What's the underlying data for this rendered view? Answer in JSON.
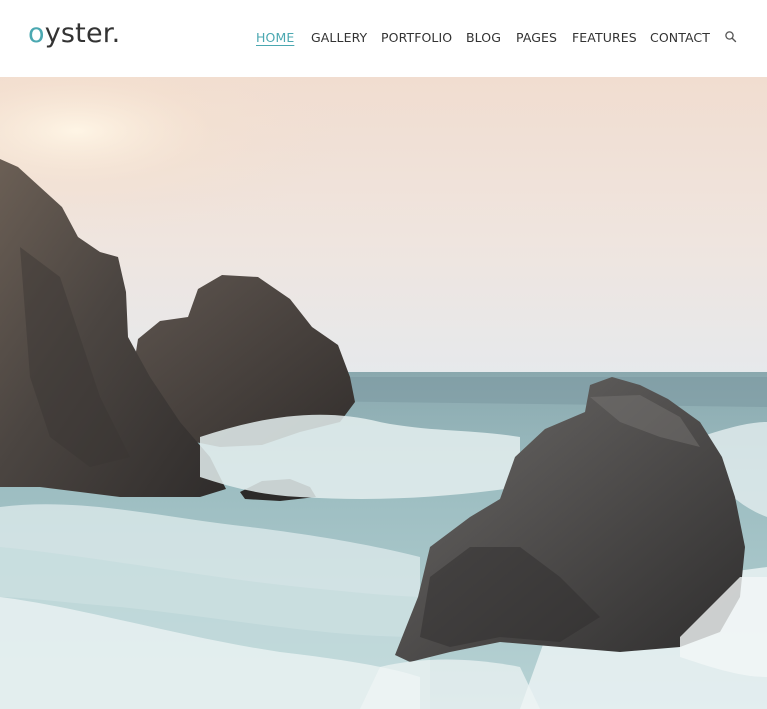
{
  "brand": {
    "logo_first": "o",
    "logo_rest": "yster.",
    "accent_color": "#4ba8b1"
  },
  "nav": {
    "items": [
      {
        "label": "HOME",
        "active": true
      },
      {
        "label": "GALLERY",
        "active": false
      },
      {
        "label": "PORTFOLIO",
        "active": false
      },
      {
        "label": "BLOG",
        "active": false
      },
      {
        "label": "PAGES",
        "active": false
      },
      {
        "label": "FEATURES",
        "active": false
      },
      {
        "label": "CONTACT",
        "active": false
      }
    ],
    "search_icon": "search-icon"
  },
  "hero": {
    "image": "seascape-rocks-waves",
    "colors": {
      "sky_top": "#f3e4da",
      "sky_bottom": "#e9eaed",
      "sea": "#8fb2b7",
      "foam": "#eef3f4",
      "rock": "#4a4746"
    }
  }
}
